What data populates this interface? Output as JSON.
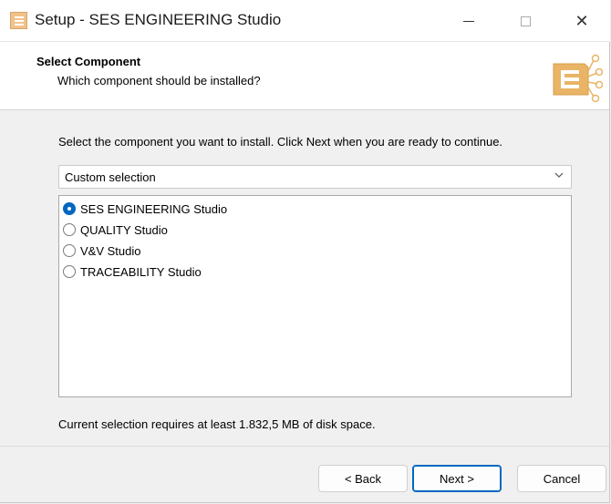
{
  "window": {
    "title": "Setup - SES ENGINEERING Studio",
    "icons": {
      "app": "app-icon",
      "minimize": "minimize-icon",
      "maximize": "maximize-icon",
      "close": "close-icon"
    },
    "close_glyph": "✕"
  },
  "header": {
    "title": "Select Component",
    "subtitle": "Which component should be installed?",
    "logo": "ses-engineering-logo"
  },
  "body": {
    "instruction": "Select the component you want to install. Click Next when you are ready to continue.",
    "dropdown": {
      "value": "Custom selection",
      "chevron": "chevron-down-icon"
    },
    "components": [
      {
        "label": "SES ENGINEERING Studio",
        "selected": true
      },
      {
        "label": "QUALITY Studio",
        "selected": false
      },
      {
        "label": "V&V Studio",
        "selected": false
      },
      {
        "label": "TRACEABILITY Studio",
        "selected": false
      }
    ],
    "disk_space": "Current selection requires at least 1.832,5 MB of disk space."
  },
  "footer": {
    "back_label": "< Back",
    "next_label": "Next >",
    "cancel_label": "Cancel"
  },
  "colors": {
    "accent": "#0067c0",
    "logo_orange": "#e9b466",
    "window_bg": "#f0f0f0",
    "header_bg": "#ffffff"
  }
}
